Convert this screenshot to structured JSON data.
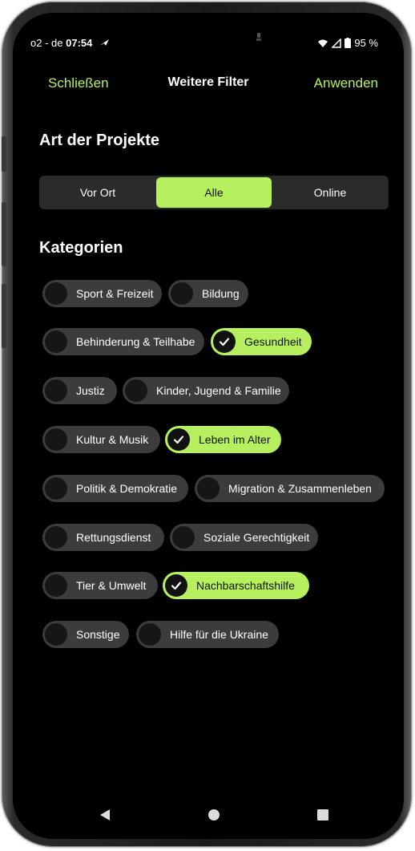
{
  "status_bar": {
    "carrier": "o2 - de",
    "time": "07:54",
    "battery": "95 %"
  },
  "header": {
    "close_label": "Schließen",
    "title": "Weitere Filter",
    "apply_label": "Anwenden"
  },
  "project_type": {
    "title": "Art der Projekte",
    "options": [
      "Vor Ort",
      "Alle",
      "Online"
    ],
    "selected": "Alle"
  },
  "categories": {
    "title": "Kategorien",
    "items": [
      {
        "label": "Sport & Freizeit",
        "selected": false
      },
      {
        "label": "Bildung",
        "selected": false
      },
      {
        "label": "Behinderung & Teilhabe",
        "selected": false
      },
      {
        "label": "Gesundheit",
        "selected": true
      },
      {
        "label": "Justiz",
        "selected": false
      },
      {
        "label": "Kinder, Jugend & Familie",
        "selected": false
      },
      {
        "label": "Kultur & Musik",
        "selected": false
      },
      {
        "label": "Leben im Alter",
        "selected": true
      },
      {
        "label": "Politik & Demokratie",
        "selected": false
      },
      {
        "label": "Migration & Zusammenleben",
        "selected": false
      },
      {
        "label": "Rettungsdienst",
        "selected": false
      },
      {
        "label": "Soziale Gerechtigkeit",
        "selected": false
      },
      {
        "label": "Tier & Umwelt",
        "selected": false
      },
      {
        "label": "Nachbarschaftshilfe",
        "selected": true
      },
      {
        "label": "Sonstige",
        "selected": false
      },
      {
        "label": "Hilfe für die Ukraine",
        "selected": false
      }
    ]
  },
  "colors": {
    "accent": "#b6f05f",
    "background": "#000000",
    "chip": "#3c3c3c"
  },
  "icons": {
    "back": "back-icon",
    "home": "home-icon",
    "recents": "recents-icon",
    "check": "check-icon"
  }
}
